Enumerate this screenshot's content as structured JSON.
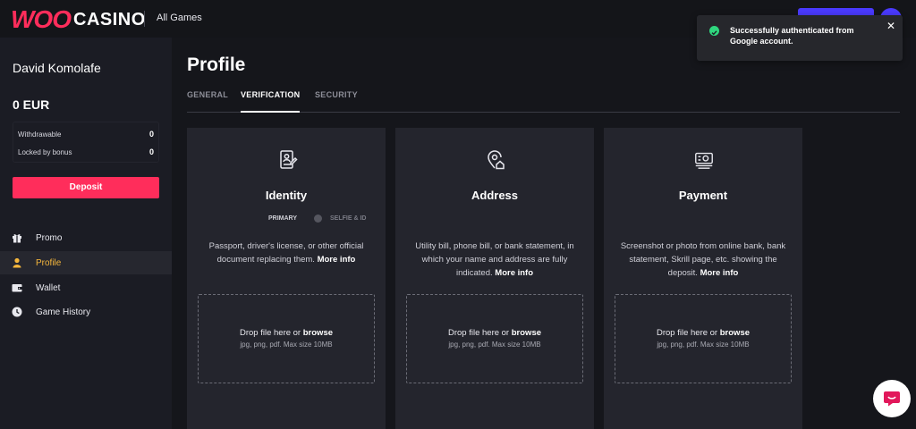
{
  "brand": {
    "logo_main": "WOO",
    "logo_sub": "CASINO",
    "accent": "#ff2d5b"
  },
  "header": {
    "all_games": "All Games"
  },
  "user": {
    "name": "David Komolafe",
    "balance": "0  EUR"
  },
  "balances": [
    {
      "label": "Withdrawable",
      "value": "0"
    },
    {
      "label": "Locked by bonus",
      "value": "0"
    }
  ],
  "sidebar": {
    "deposit_label": "Deposit",
    "items": [
      {
        "label": "Promo",
        "icon": "gift-icon"
      },
      {
        "label": "Profile",
        "icon": "user-icon",
        "active": true
      },
      {
        "label": "Wallet",
        "icon": "wallet-icon"
      },
      {
        "label": "Game History",
        "icon": "clock-icon"
      }
    ]
  },
  "page": {
    "title": "Profile",
    "tabs": [
      "GENERAL",
      "VERIFICATION",
      "SECURITY"
    ],
    "active_tab": "VERIFICATION"
  },
  "cards": [
    {
      "title": "Identity",
      "icon": "id-document-icon",
      "steps": [
        "PRIMARY",
        "SELFIE & ID"
      ],
      "desc": "Passport, driver's license, or other official document replacing them.",
      "more": "More info",
      "drop_prefix": "Drop file here or ",
      "drop_link": "browse",
      "drop_hint": "jpg, png, pdf. Max size 10MB"
    },
    {
      "title": "Address",
      "icon": "location-home-icon",
      "desc": "Utility bill, phone bill, or bank statement, in which your name and address are fully indicated.",
      "more": "More info",
      "drop_prefix": "Drop file here or ",
      "drop_link": "browse",
      "drop_hint": "jpg, png, pdf. Max size 10MB"
    },
    {
      "title": "Payment",
      "icon": "payment-card-icon",
      "desc": "Screenshot or photo from online bank, bank statement, Skrill page, etc. showing the deposit.",
      "more": "More info",
      "drop_prefix": "Drop file here or ",
      "drop_link": "browse",
      "drop_hint": "jpg, png, pdf. Max size 10MB"
    }
  ],
  "toast": {
    "message": "Successfully authenticated from Google account.",
    "status_color": "#2fd67e"
  }
}
